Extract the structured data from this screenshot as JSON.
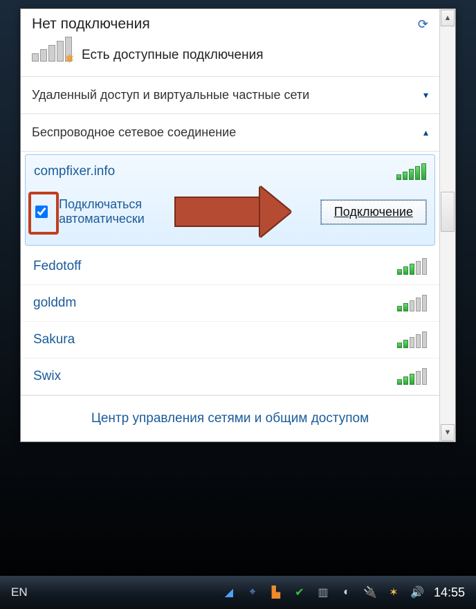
{
  "header": {
    "title": "Нет подключения",
    "available_text": "Есть доступные подключения"
  },
  "sections": {
    "vpn_header": "Удаленный доступ и виртуальные частные сети",
    "wifi_header": "Беспроводное сетевое соединение"
  },
  "selected_network": {
    "name": "compfixer.info",
    "auto_line1": "Подключаться",
    "auto_line2": "автоматически",
    "connect_label": "Подключение"
  },
  "networks": [
    {
      "name": "Fedotoff",
      "strength": 3
    },
    {
      "name": "golddm",
      "strength": 2
    },
    {
      "name": "Sakura",
      "strength": 2
    },
    {
      "name": "Swix",
      "strength": 3
    }
  ],
  "footer": {
    "link": "Центр управления сетями и общим доступом"
  },
  "taskbar": {
    "lang": "EN",
    "clock": "14:55"
  }
}
